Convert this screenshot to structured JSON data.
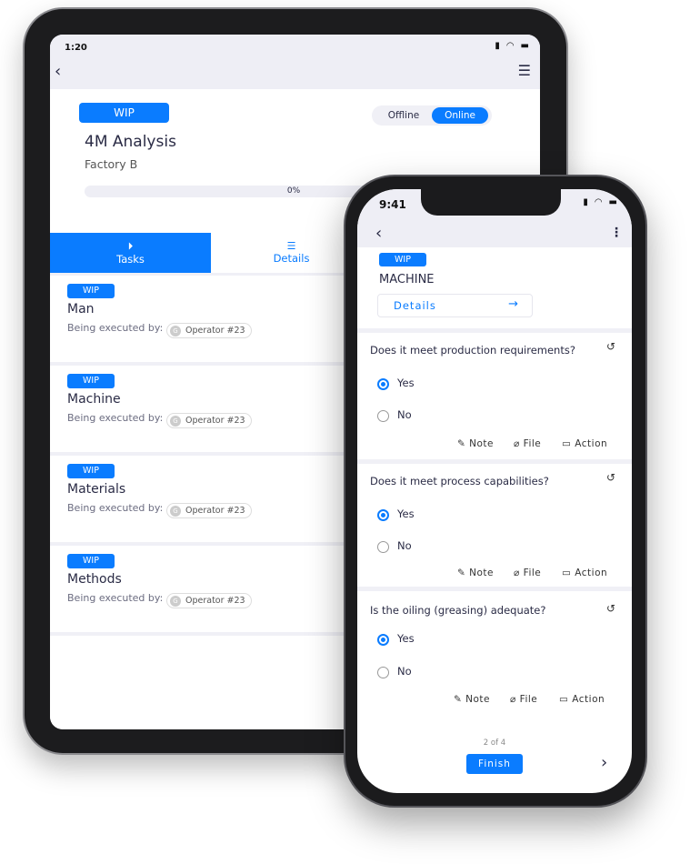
{
  "tablet": {
    "time": "1:20",
    "status": {
      "badge": "WIP",
      "offline": "Offline",
      "online": "Online",
      "mode": "Online"
    },
    "title": "4M Analysis",
    "subtitle": "Factory B",
    "progress": "0%",
    "progress_value": 0,
    "tabs": [
      {
        "label": "Tasks",
        "icon": "play-circle-icon",
        "active": true
      },
      {
        "label": "Details",
        "icon": "list-icon",
        "active": false
      }
    ],
    "tasks": [
      {
        "badge": "WIP",
        "title": "Man",
        "executed_label": "Being executed by:",
        "avatar": "G",
        "operator": "Operator #23"
      },
      {
        "badge": "WIP",
        "title": "Machine",
        "executed_label": "Being executed by:",
        "avatar": "G",
        "operator": "Operator #23"
      },
      {
        "badge": "WIP",
        "title": "Materials",
        "executed_label": "Being executed by:",
        "avatar": "G",
        "operator": "Operator #23"
      },
      {
        "badge": "WIP",
        "title": "Methods",
        "executed_label": "Being executed by:",
        "avatar": "G",
        "operator": "Operator #23"
      }
    ]
  },
  "phone": {
    "time": "9:41",
    "badge": "WIP",
    "title": "MACHINE",
    "details_label": "Details",
    "questions": [
      {
        "text": "Does it meet production requirements?",
        "yes": "Yes",
        "no": "No",
        "selected": "Yes",
        "note": "Note",
        "file": "File",
        "action": "Action"
      },
      {
        "text": "Does it meet process capabilities?",
        "yes": "Yes",
        "no": "No",
        "selected": "Yes",
        "note": "Note",
        "file": "File",
        "action": "Action"
      },
      {
        "text": "Is the oiling (greasing) adequate?",
        "yes": "Yes",
        "no": "No",
        "selected": "Yes",
        "note": "Note",
        "file": "File",
        "action": "Action"
      }
    ],
    "pager": "2 of 4",
    "finish": "Finish"
  },
  "colors": {
    "accent": "#0a7cff",
    "text": "#2a2b45",
    "background": "#f0f0f6"
  }
}
